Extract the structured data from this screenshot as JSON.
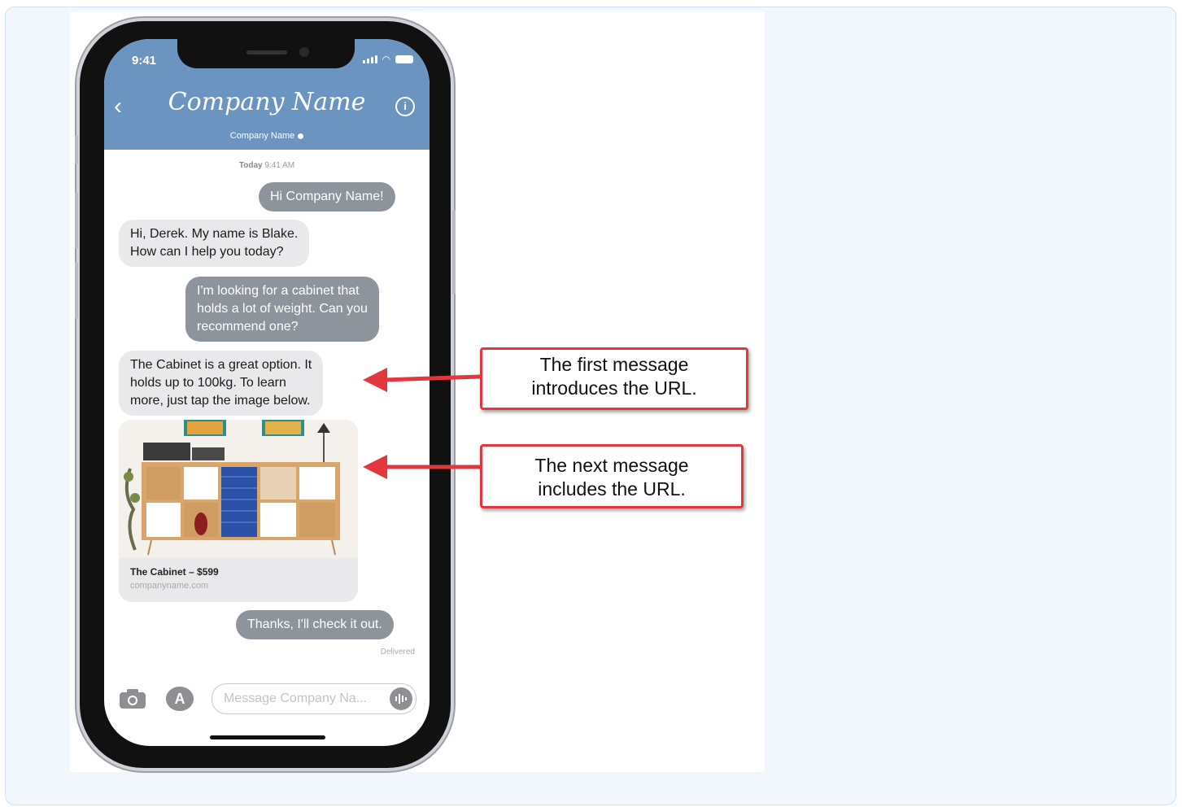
{
  "status_bar": {
    "time": "9:41"
  },
  "header": {
    "back_icon": "chevron-left-icon",
    "title": "Company Name",
    "subtitle": "Company Name",
    "info_icon": "info-icon"
  },
  "conversation": {
    "date_label": "Today",
    "time_label": "9:41 AM",
    "messages": [
      {
        "from": "user",
        "text": "Hi Company Name!"
      },
      {
        "from": "agent",
        "lines": [
          "Hi, Derek. My name is Blake.",
          "How can I help you today?"
        ]
      },
      {
        "from": "user",
        "lines": [
          "I'm looking for a cabinet that",
          "holds a lot of weight. Can you",
          "recommend one?"
        ]
      },
      {
        "from": "agent",
        "lines": [
          "The Cabinet is a great option. It",
          "holds up to 100kg. To learn",
          "more, just tap the image below."
        ]
      },
      {
        "from": "user",
        "text": "Thanks, I'll check it out."
      }
    ],
    "link_card": {
      "title": "The Cabinet – $599",
      "url": "companyname.com"
    },
    "delivered_label": "Delivered"
  },
  "composer": {
    "camera_icon": "camera-icon",
    "apps_icon": "app-store-icon",
    "placeholder": "Message Company Na...",
    "audio_icon": "audio-waveform-icon"
  },
  "callouts": [
    {
      "lines": [
        "The first message",
        "introduces the URL."
      ]
    },
    {
      "lines": [
        "The next message",
        "includes the URL."
      ]
    }
  ],
  "colors": {
    "header_blue": "#6b94c0",
    "outgoing_bubble": "#8d949c",
    "incoming_bubble": "#e9e9eb",
    "callout_red": "#e2383d"
  }
}
